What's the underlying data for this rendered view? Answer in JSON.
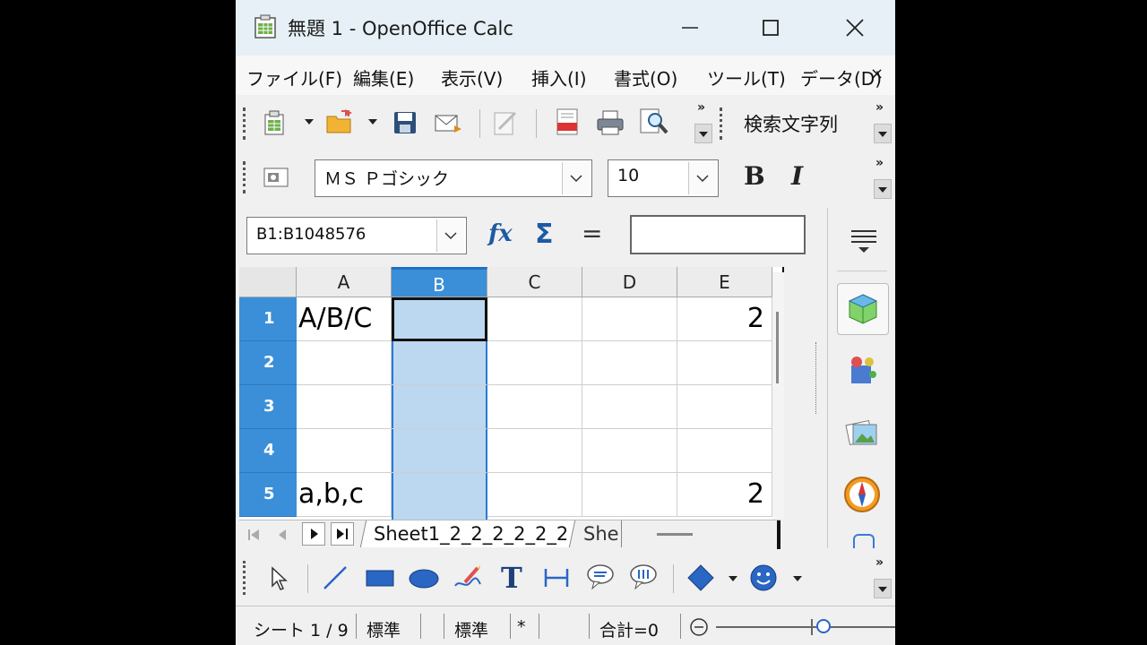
{
  "window": {
    "title": "無題 1 - OpenOffice Calc",
    "minimize_glyph": "—",
    "maximize_glyph": "☐",
    "close_glyph": "✕"
  },
  "menu": {
    "items": [
      "ファイル(F)",
      "編集(E)",
      "表示(V)",
      "挿入(I)",
      "書式(O)",
      "ツール(T)",
      "データ(D)"
    ],
    "overflow": "×"
  },
  "toolbar": {
    "search_text": "検索文字列",
    "overflow": "»"
  },
  "format_bar": {
    "font_name": "ＭＳ Ｐゴシック",
    "font_size": "10",
    "bold_label": "B",
    "italic_label": "I"
  },
  "formula_bar": {
    "name_box": "B1:B1048576",
    "fx_label": "fx",
    "sum_label": "Σ",
    "equals_label": "=",
    "input_value": ""
  },
  "sheet": {
    "columns": [
      "A",
      "B",
      "C",
      "D",
      "E"
    ],
    "rows": [
      {
        "num": "1",
        "A": "A/B/C",
        "E": "2"
      },
      {
        "num": "2",
        "A": "",
        "E": ""
      },
      {
        "num": "3",
        "A": "",
        "E": ""
      },
      {
        "num": "4",
        "A": "",
        "E": ""
      },
      {
        "num": "5",
        "A": "a,b,c",
        "E": "2"
      }
    ],
    "selected_column": "B",
    "tabs": [
      "Sheet1_2_2_2_2_2_2",
      "She"
    ]
  },
  "statusbar": {
    "sheet_pos": "シート 1 / 9",
    "page_style": "標準",
    "mode": "標準",
    "modified": "*",
    "sum": "合計=0"
  },
  "colors": {
    "selection_fill": "#bcd7f0",
    "selection_border": "#2a7bd4",
    "row_header": "#3b8fd8",
    "titlebar": "#e6f0f6"
  }
}
